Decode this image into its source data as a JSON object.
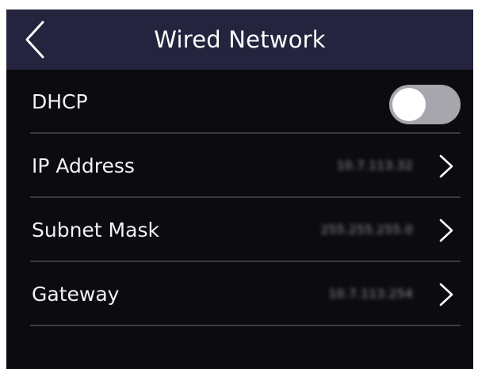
{
  "header": {
    "title": "Wired Network",
    "back_icon": "chevron-left-icon"
  },
  "settings": {
    "dhcp": {
      "label": "DHCP",
      "enabled": false
    },
    "ip_address": {
      "label": "IP Address",
      "value": "10.7.113.32",
      "icon": "chevron-right-icon"
    },
    "subnet_mask": {
      "label": "Subnet Mask",
      "value": "255.255.255.0",
      "icon": "chevron-right-icon"
    },
    "gateway": {
      "label": "Gateway",
      "value": "10.7.113.254",
      "icon": "chevron-right-icon"
    }
  },
  "colors": {
    "header_bg": "#25243f",
    "screen_bg": "#0c0c10",
    "divider": "#3a3a44",
    "toggle_off": "#a6a6ac",
    "text": "#f2f2f2"
  }
}
